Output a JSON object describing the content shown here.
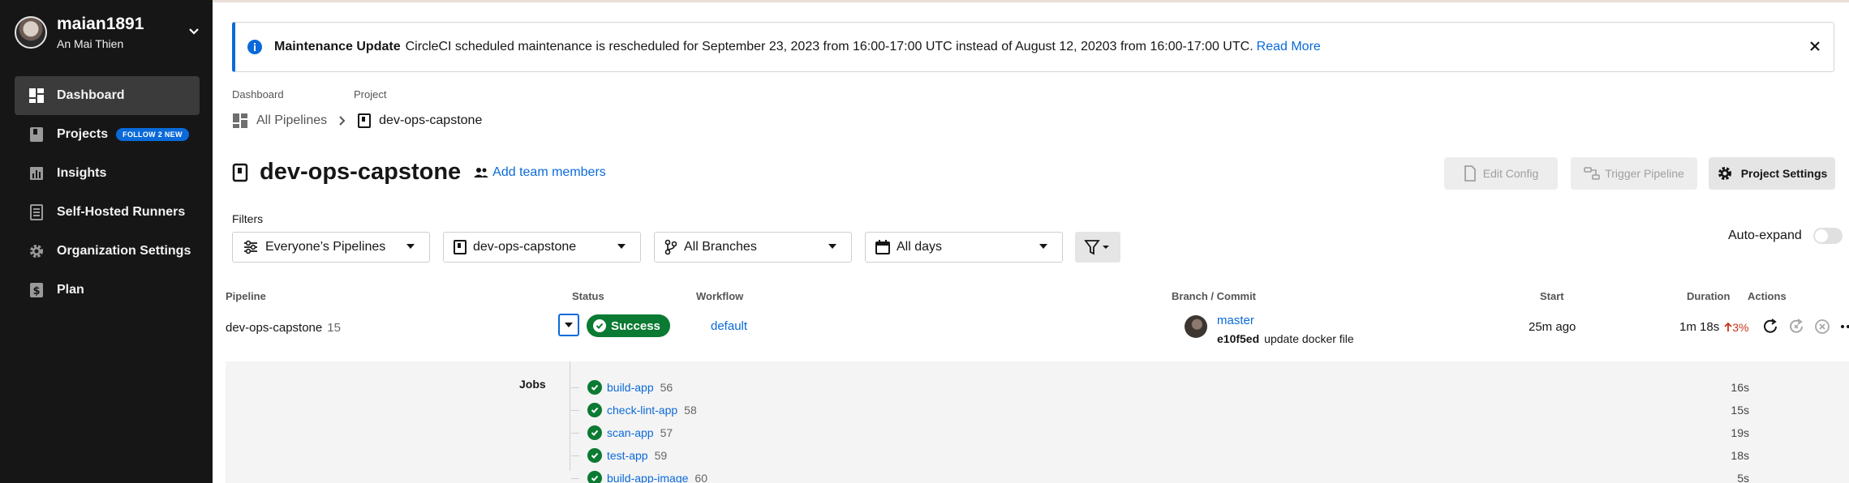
{
  "user": {
    "username": "maian1891",
    "full_name": "An Mai Thien"
  },
  "nav": [
    {
      "label": "Dashboard",
      "icon": "dashboard-icon",
      "active": true
    },
    {
      "label": "Projects",
      "icon": "book-icon",
      "badge": "FOLLOW 2 NEW"
    },
    {
      "label": "Insights",
      "icon": "insights-icon"
    },
    {
      "label": "Self-Hosted Runners",
      "icon": "runner-icon"
    },
    {
      "label": "Organization Settings",
      "icon": "gear-icon"
    },
    {
      "label": "Plan",
      "icon": "dollar-icon"
    }
  ],
  "banner": {
    "title": "Maintenance Update",
    "message": "CircleCI scheduled maintenance is rescheduled for September 23, 2023 from 16:00-17:00 UTC instead of August 12, 20203 from 16:00-17:00 UTC.",
    "link": "Read More"
  },
  "breadcrumb": {
    "label1": "Dashboard",
    "label2": "Project",
    "item1": "All Pipelines",
    "item2": "dev-ops-capstone"
  },
  "project": {
    "title": "dev-ops-capstone",
    "add_team": "Add team members"
  },
  "buttons": {
    "edit_config": "Edit Config",
    "trigger": "Trigger Pipeline",
    "settings": "Project Settings"
  },
  "filters": {
    "label": "Filters",
    "pipelines": "Everyone’s Pipelines",
    "project": "dev-ops-capstone",
    "branches": "All Branches",
    "days": "All days",
    "auto_expand": "Auto-expand"
  },
  "table": {
    "headers": {
      "pipeline": "Pipeline",
      "status": "Status",
      "workflow": "Workflow",
      "branch": "Branch / Commit",
      "start": "Start",
      "duration": "Duration",
      "actions": "Actions"
    },
    "row": {
      "pipeline": "dev-ops-capstone",
      "number": "15",
      "status": "Success",
      "workflow": "default",
      "branch": "master",
      "commit_hash": "e10f5ed",
      "commit_msg": "update docker file",
      "start": "25m ago",
      "duration": "1m 18s",
      "delta": "3%"
    },
    "jobs_label": "Jobs",
    "jobs": [
      {
        "name": "build-app",
        "num": "56",
        "dur": "16s"
      },
      {
        "name": "check-lint-app",
        "num": "58",
        "dur": "15s"
      },
      {
        "name": "scan-app",
        "num": "57",
        "dur": "19s"
      },
      {
        "name": "test-app",
        "num": "59",
        "dur": "18s"
      },
      {
        "name": "build-app-image",
        "num": "60",
        "dur": "5s"
      }
    ]
  },
  "colors": {
    "accent": "#0a6ad9",
    "success": "#0b7a32",
    "sidebar": "#161616"
  }
}
